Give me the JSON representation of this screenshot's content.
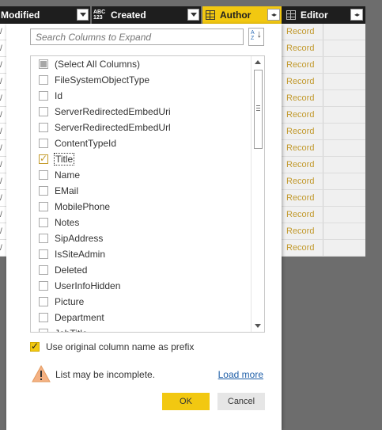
{
  "columns": {
    "modified": {
      "label": "Modified"
    },
    "created": {
      "label": "Created",
      "type_icon_top": "ABC",
      "type_icon_bottom": "123"
    },
    "author": {
      "label": "Author",
      "expand_icon": "expand-icon"
    },
    "editor": {
      "label": "Editor",
      "expand_icon": "expand-icon"
    }
  },
  "grid": {
    "left_values": [
      "/",
      "/",
      "/",
      "/",
      "/",
      "/",
      "/",
      "/",
      "/",
      "/",
      "/",
      "/",
      "/",
      "/"
    ],
    "record_cells": [
      "Record",
      "Record",
      "Record",
      "Record",
      "Record",
      "Record",
      "Record",
      "Record",
      "Record",
      "Record",
      "Record",
      "Record",
      "Record",
      "Record"
    ]
  },
  "dialog": {
    "search_placeholder": "Search Columns to Expand",
    "sort_icon_label": "A Z",
    "items": [
      {
        "label": "(Select All Columns)",
        "state": "partial"
      },
      {
        "label": "FileSystemObjectType",
        "state": "unchecked"
      },
      {
        "label": "Id",
        "state": "unchecked"
      },
      {
        "label": "ServerRedirectedEmbedUri",
        "state": "unchecked"
      },
      {
        "label": "ServerRedirectedEmbedUrl",
        "state": "unchecked"
      },
      {
        "label": "ContentTypeId",
        "state": "unchecked"
      },
      {
        "label": "Title",
        "state": "checked"
      },
      {
        "label": "Name",
        "state": "unchecked"
      },
      {
        "label": "EMail",
        "state": "unchecked"
      },
      {
        "label": "MobilePhone",
        "state": "unchecked"
      },
      {
        "label": "Notes",
        "state": "unchecked"
      },
      {
        "label": "SipAddress",
        "state": "unchecked"
      },
      {
        "label": "IsSiteAdmin",
        "state": "unchecked"
      },
      {
        "label": "Deleted",
        "state": "unchecked"
      },
      {
        "label": "UserInfoHidden",
        "state": "unchecked"
      },
      {
        "label": "Picture",
        "state": "unchecked"
      },
      {
        "label": "Department",
        "state": "unchecked"
      },
      {
        "label": "JobTitle",
        "state": "unchecked"
      }
    ],
    "prefix_label": "Use original column name as prefix",
    "prefix_checked": true,
    "warning_text": "List may be incomplete.",
    "load_more": "Load more",
    "ok_label": "OK",
    "cancel_label": "Cancel"
  },
  "colors": {
    "accent": "#f2c811",
    "record_text": "#c29a2e",
    "header_bg": "#1e1e1e",
    "backdrop": "#6d6d6d"
  }
}
